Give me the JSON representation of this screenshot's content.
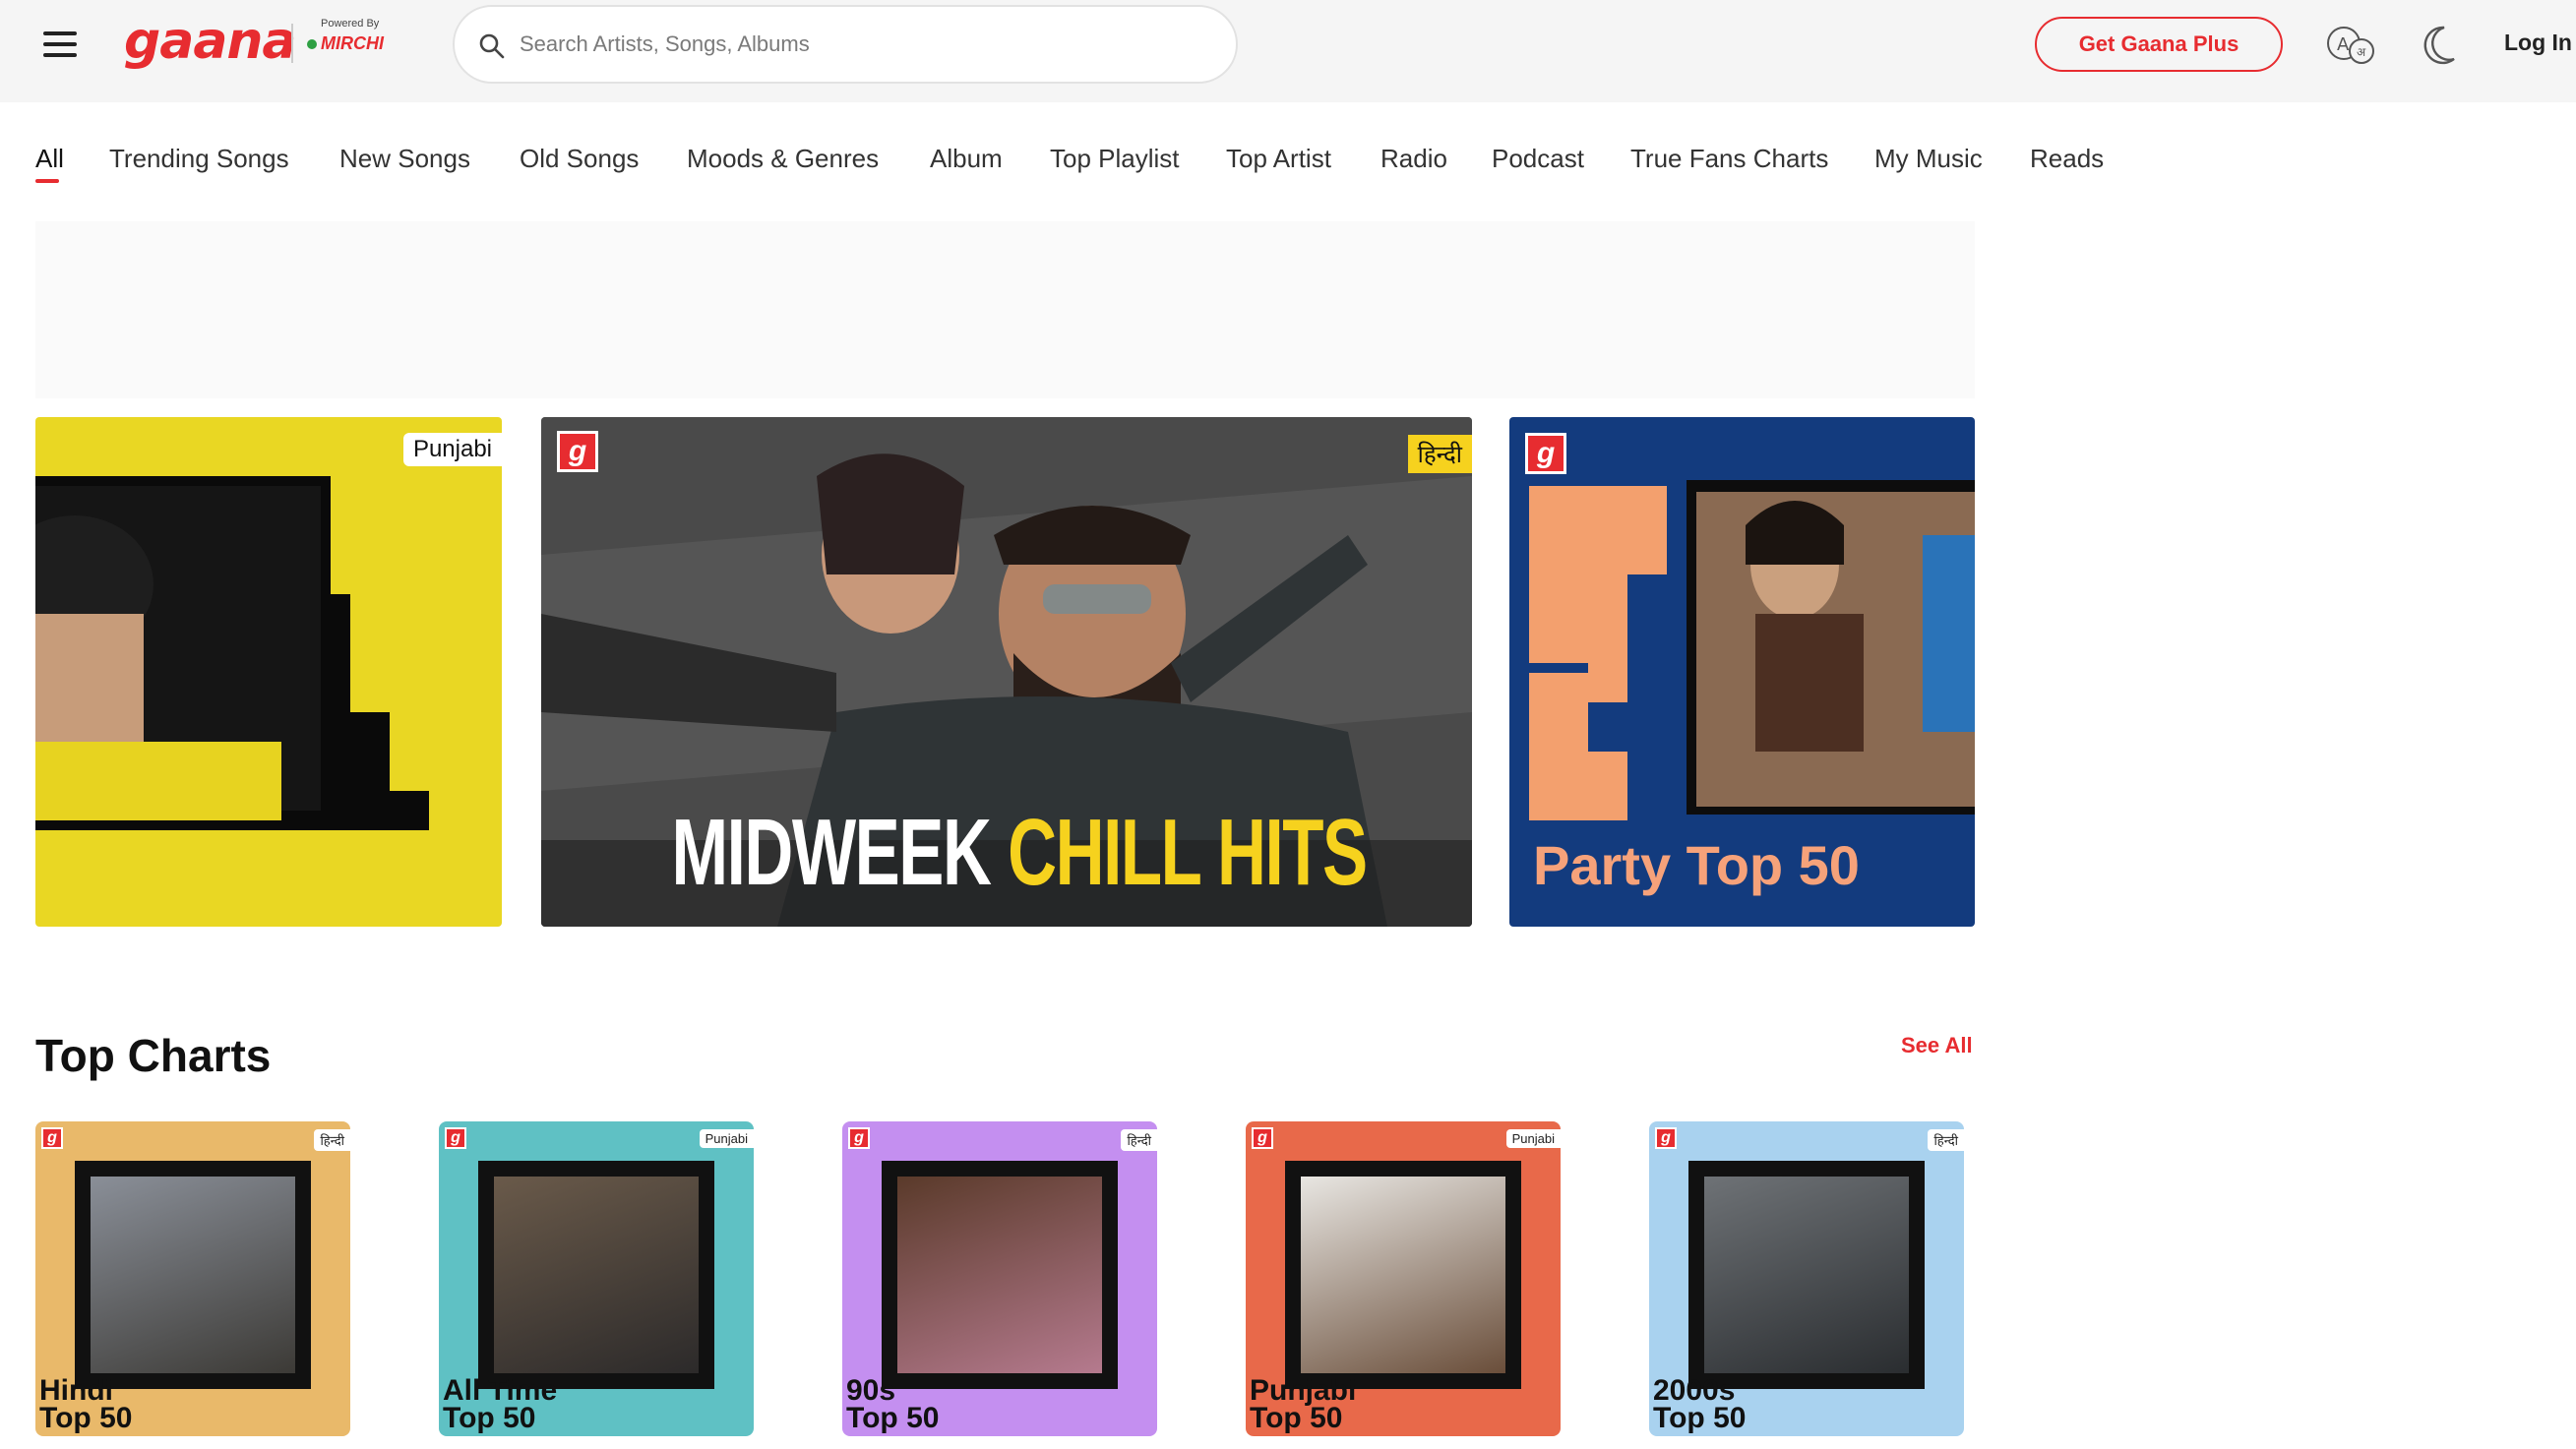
{
  "header": {
    "logo_text": "gaana",
    "powered_by": "Powered By",
    "partner": "MIRCHI",
    "search_placeholder": "Search Artists, Songs, Albums",
    "plus_label": "Get Gaana Plus",
    "login_label": "Log In"
  },
  "tabs": [
    {
      "label": "All",
      "active": true
    },
    {
      "label": "Trending Songs"
    },
    {
      "label": "New Songs"
    },
    {
      "label": "Old Songs"
    },
    {
      "label": "Moods & Genres"
    },
    {
      "label": "Album"
    },
    {
      "label": "Top Playlist"
    },
    {
      "label": "Top Artist"
    },
    {
      "label": "Radio"
    },
    {
      "label": "Podcast"
    },
    {
      "label": "True Fans Charts"
    },
    {
      "label": "My Music"
    },
    {
      "label": "Reads"
    }
  ],
  "carousel": {
    "punjabi": {
      "badge": "Punjabi"
    },
    "chill": {
      "badge": "हिन्दी",
      "title_white": "MIDWEEK",
      "title_yellow": "CHILL HITS"
    },
    "party": {
      "title": "Party Top 50"
    }
  },
  "top_charts": {
    "title": "Top Charts",
    "see_all": "See All",
    "items": [
      {
        "name": "Hindi\nTop 50",
        "lang": "हिन्दी",
        "bg": "#e9b96a"
      },
      {
        "name": "All Time\nTop 50",
        "lang": "Punjabi",
        "bg": "#5fc1c4"
      },
      {
        "name": "90s\nTop 50",
        "lang": "हिन्दी",
        "bg": "#c48ff0"
      },
      {
        "name": "Punjabi\nTop 50",
        "lang": "Punjabi",
        "bg": "#e8694a"
      },
      {
        "name": "2000s\nTop 50",
        "lang": "हिन्दी",
        "bg": "#a9d2ef"
      }
    ]
  },
  "colors": {
    "brand": "#e72c30",
    "accent_yellow": "#f6d21e"
  }
}
